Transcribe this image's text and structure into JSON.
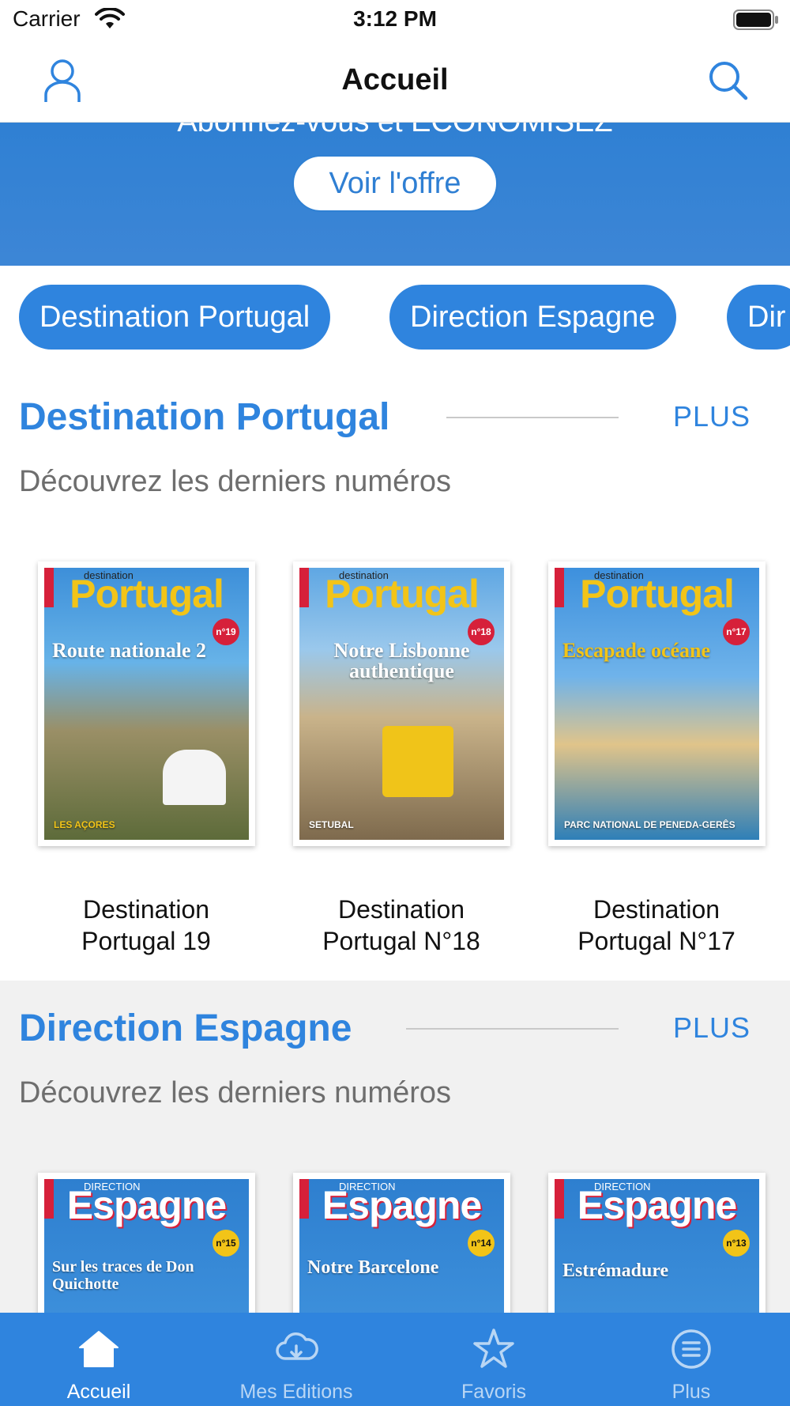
{
  "status": {
    "carrier": "Carrier",
    "time": "3:12 PM"
  },
  "nav": {
    "title": "Accueil"
  },
  "promo": {
    "text": "Abonnez-vous et ÉCONOMISEZ",
    "button": "Voir l'offre"
  },
  "chips": [
    "Destination Portugal",
    "Direction Espagne",
    "Dir"
  ],
  "sections": [
    {
      "title": "Destination Portugal",
      "more": "PLUS",
      "subtitle": "Découvrez les derniers numéros",
      "covers": [
        {
          "caption_line1": "Destination",
          "caption_line2": "Portugal 19",
          "masthead": "Portugal",
          "pre": "destination",
          "issue": "n°19",
          "headline": "Route nationale 2",
          "kicker": "LES AÇORES"
        },
        {
          "caption_line1": "Destination",
          "caption_line2": "Portugal N°18",
          "masthead": "Portugal",
          "pre": "destination",
          "issue": "n°18",
          "headline": "Notre Lisbonne authentique",
          "kicker": "SETUBAL"
        },
        {
          "caption_line1": "Destination",
          "caption_line2": "Portugal N°17",
          "masthead": "Portugal",
          "pre": "destination",
          "issue": "n°17",
          "headline": "Escapade océane",
          "kicker": "PARC NATIONAL DE PENEDA-GERÊS"
        }
      ]
    },
    {
      "title": "Direction Espagne",
      "more": "PLUS",
      "subtitle": "Découvrez les derniers numéros",
      "covers": [
        {
          "masthead": "Espagne",
          "pre": "DIRECTION",
          "issue": "n°15",
          "headline": "Sur les traces de Don Quichotte"
        },
        {
          "masthead": "Espagne",
          "pre": "DIRECTION",
          "issue": "n°14",
          "headline": "Notre Barcelone"
        },
        {
          "masthead": "Espagne",
          "pre": "DIRECTION",
          "issue": "n°13",
          "headline": "Estrémadure"
        }
      ]
    }
  ],
  "tabs": [
    {
      "label": "Accueil",
      "icon": "home-icon",
      "active": true
    },
    {
      "label": "Mes Editions",
      "icon": "cloud-download-icon",
      "active": false
    },
    {
      "label": "Favoris",
      "icon": "star-icon",
      "active": false
    },
    {
      "label": "Plus",
      "icon": "menu-circle-icon",
      "active": false
    }
  ],
  "colors": {
    "accent": "#2f84de",
    "tab_active": "#ffffff",
    "tab_inactive": "#b9d6f4"
  }
}
